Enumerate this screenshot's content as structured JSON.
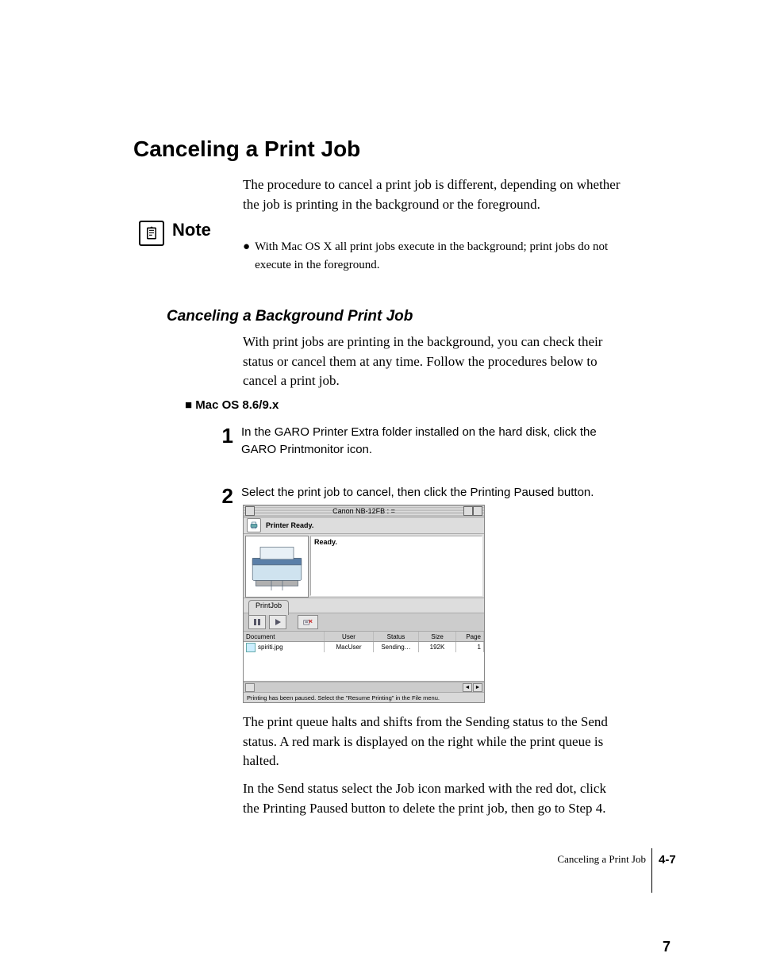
{
  "h1": "Canceling a Print Job",
  "intro": "The procedure to cancel a print job is different, depending on whether the job is printing in the background or the foreground.",
  "note": {
    "label": "Note",
    "bullet": "With Mac OS X all print jobs execute in the background; print jobs do not execute in the foreground."
  },
  "h2": "Canceling a Background Print Job",
  "h2_body": "With print jobs are printing in the background, you can check their status or cancel them at any time. Follow the procedures below to cancel a print job.",
  "h3": "Mac OS 8.6/9.x",
  "steps": {
    "s1_num": "1",
    "s1_text": "In the GARO Printer Extra folder installed on the hard disk, click the GARO Printmonitor icon.",
    "s2_num": "2",
    "s2_text": "Select the print job to cancel, then click the Printing Paused button."
  },
  "screenshot": {
    "title": "Canon NB-12FB : =",
    "printer_ready": "Printer Ready.",
    "ready": "Ready.",
    "tab": "PrintJob",
    "columns": {
      "doc": "Document",
      "user": "User",
      "status": "Status",
      "size": "Size",
      "page": "Page"
    },
    "row": {
      "doc": "spiriti.jpg",
      "user": "MacUser",
      "status": "Sending…",
      "size": "192K",
      "page": "1"
    },
    "footer": "Printing has been paused. Select the \"Resume Printing\" in the File menu.",
    "scroll_left": "◄",
    "scroll_right": "►"
  },
  "after": {
    "p1": "The print queue halts and shifts from the Sending status to the Send status. A red mark is displayed on the right while the print queue is halted.",
    "p2": "In the Send status select the Job icon marked with the red dot, click the Printing Paused button to delete the print job, then go to Step 4."
  },
  "footer": {
    "text": "Canceling a Print Job",
    "code": "4-7",
    "page": "7"
  }
}
